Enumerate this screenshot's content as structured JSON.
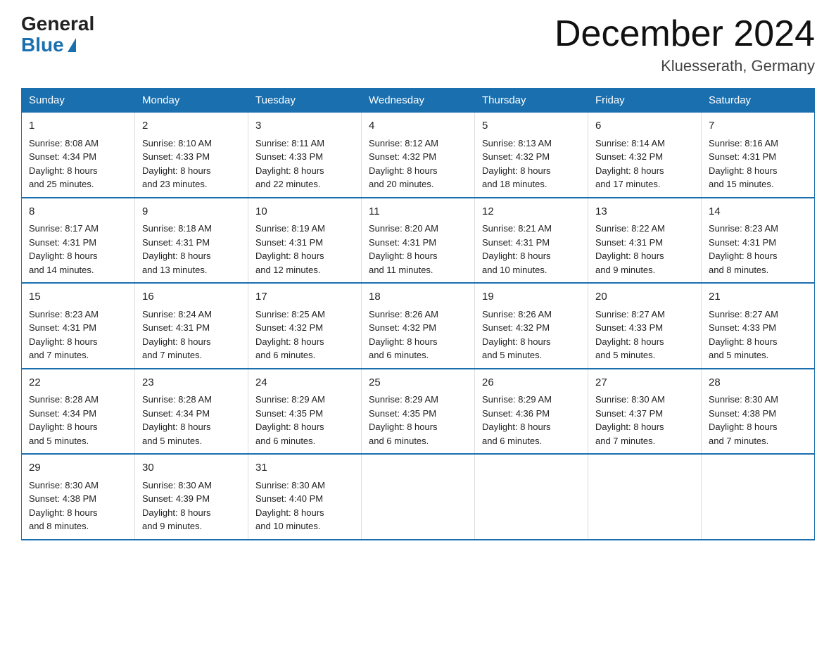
{
  "header": {
    "logo_general": "General",
    "logo_blue": "Blue",
    "month_title": "December 2024",
    "location": "Kluesserath, Germany"
  },
  "days_of_week": [
    "Sunday",
    "Monday",
    "Tuesday",
    "Wednesday",
    "Thursday",
    "Friday",
    "Saturday"
  ],
  "weeks": [
    [
      {
        "day": "1",
        "sunrise": "8:08 AM",
        "sunset": "4:34 PM",
        "daylight": "8 hours and 25 minutes."
      },
      {
        "day": "2",
        "sunrise": "8:10 AM",
        "sunset": "4:33 PM",
        "daylight": "8 hours and 23 minutes."
      },
      {
        "day": "3",
        "sunrise": "8:11 AM",
        "sunset": "4:33 PM",
        "daylight": "8 hours and 22 minutes."
      },
      {
        "day": "4",
        "sunrise": "8:12 AM",
        "sunset": "4:32 PM",
        "daylight": "8 hours and 20 minutes."
      },
      {
        "day": "5",
        "sunrise": "8:13 AM",
        "sunset": "4:32 PM",
        "daylight": "8 hours and 18 minutes."
      },
      {
        "day": "6",
        "sunrise": "8:14 AM",
        "sunset": "4:32 PM",
        "daylight": "8 hours and 17 minutes."
      },
      {
        "day": "7",
        "sunrise": "8:16 AM",
        "sunset": "4:31 PM",
        "daylight": "8 hours and 15 minutes."
      }
    ],
    [
      {
        "day": "8",
        "sunrise": "8:17 AM",
        "sunset": "4:31 PM",
        "daylight": "8 hours and 14 minutes."
      },
      {
        "day": "9",
        "sunrise": "8:18 AM",
        "sunset": "4:31 PM",
        "daylight": "8 hours and 13 minutes."
      },
      {
        "day": "10",
        "sunrise": "8:19 AM",
        "sunset": "4:31 PM",
        "daylight": "8 hours and 12 minutes."
      },
      {
        "day": "11",
        "sunrise": "8:20 AM",
        "sunset": "4:31 PM",
        "daylight": "8 hours and 11 minutes."
      },
      {
        "day": "12",
        "sunrise": "8:21 AM",
        "sunset": "4:31 PM",
        "daylight": "8 hours and 10 minutes."
      },
      {
        "day": "13",
        "sunrise": "8:22 AM",
        "sunset": "4:31 PM",
        "daylight": "8 hours and 9 minutes."
      },
      {
        "day": "14",
        "sunrise": "8:23 AM",
        "sunset": "4:31 PM",
        "daylight": "8 hours and 8 minutes."
      }
    ],
    [
      {
        "day": "15",
        "sunrise": "8:23 AM",
        "sunset": "4:31 PM",
        "daylight": "8 hours and 7 minutes."
      },
      {
        "day": "16",
        "sunrise": "8:24 AM",
        "sunset": "4:31 PM",
        "daylight": "8 hours and 7 minutes."
      },
      {
        "day": "17",
        "sunrise": "8:25 AM",
        "sunset": "4:32 PM",
        "daylight": "8 hours and 6 minutes."
      },
      {
        "day": "18",
        "sunrise": "8:26 AM",
        "sunset": "4:32 PM",
        "daylight": "8 hours and 6 minutes."
      },
      {
        "day": "19",
        "sunrise": "8:26 AM",
        "sunset": "4:32 PM",
        "daylight": "8 hours and 5 minutes."
      },
      {
        "day": "20",
        "sunrise": "8:27 AM",
        "sunset": "4:33 PM",
        "daylight": "8 hours and 5 minutes."
      },
      {
        "day": "21",
        "sunrise": "8:27 AM",
        "sunset": "4:33 PM",
        "daylight": "8 hours and 5 minutes."
      }
    ],
    [
      {
        "day": "22",
        "sunrise": "8:28 AM",
        "sunset": "4:34 PM",
        "daylight": "8 hours and 5 minutes."
      },
      {
        "day": "23",
        "sunrise": "8:28 AM",
        "sunset": "4:34 PM",
        "daylight": "8 hours and 5 minutes."
      },
      {
        "day": "24",
        "sunrise": "8:29 AM",
        "sunset": "4:35 PM",
        "daylight": "8 hours and 6 minutes."
      },
      {
        "day": "25",
        "sunrise": "8:29 AM",
        "sunset": "4:35 PM",
        "daylight": "8 hours and 6 minutes."
      },
      {
        "day": "26",
        "sunrise": "8:29 AM",
        "sunset": "4:36 PM",
        "daylight": "8 hours and 6 minutes."
      },
      {
        "day": "27",
        "sunrise": "8:30 AM",
        "sunset": "4:37 PM",
        "daylight": "8 hours and 7 minutes."
      },
      {
        "day": "28",
        "sunrise": "8:30 AM",
        "sunset": "4:38 PM",
        "daylight": "8 hours and 7 minutes."
      }
    ],
    [
      {
        "day": "29",
        "sunrise": "8:30 AM",
        "sunset": "4:38 PM",
        "daylight": "8 hours and 8 minutes."
      },
      {
        "day": "30",
        "sunrise": "8:30 AM",
        "sunset": "4:39 PM",
        "daylight": "8 hours and 9 minutes."
      },
      {
        "day": "31",
        "sunrise": "8:30 AM",
        "sunset": "4:40 PM",
        "daylight": "8 hours and 10 minutes."
      },
      null,
      null,
      null,
      null
    ]
  ],
  "labels": {
    "sunrise": "Sunrise:",
    "sunset": "Sunset:",
    "daylight": "Daylight:"
  }
}
